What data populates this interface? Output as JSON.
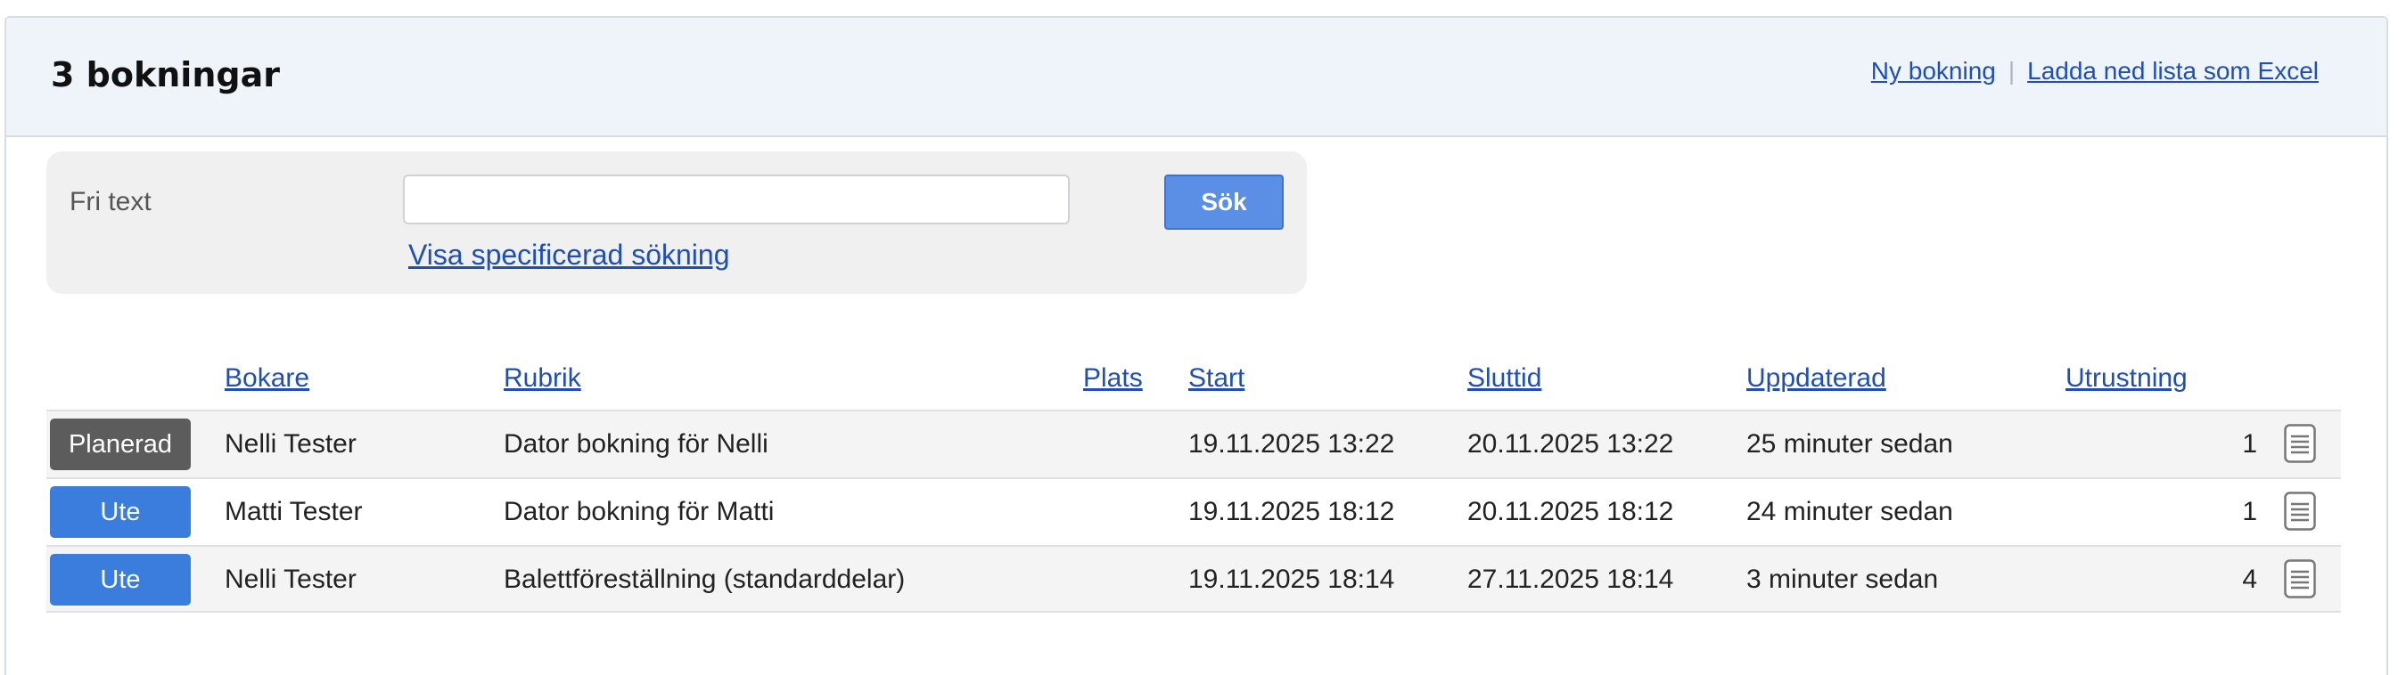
{
  "header": {
    "title": "3 bokningar",
    "links": {
      "new_booking": "Ny bokning",
      "separator": "|",
      "download_excel": "Ladda ned lista som Excel"
    }
  },
  "search": {
    "label": "Fri text",
    "input_value": "",
    "input_placeholder": "",
    "button_label": "Sök",
    "advanced_link": "Visa specificerad sökning"
  },
  "table": {
    "columns": {
      "booker": "Bokare",
      "title": "Rubrik",
      "place": "Plats",
      "start": "Start",
      "end": "Sluttid",
      "updated": "Uppdaterad",
      "equipment": "Utrustning"
    },
    "rows": [
      {
        "status": "Planerad",
        "status_color": "#5c5c5c",
        "booker": "Nelli Tester",
        "title": "Dator bokning för Nelli",
        "place": "",
        "start": "19.11.2025 13:22",
        "end": "20.11.2025 13:22",
        "updated": "25 minuter sedan",
        "equipment": "1",
        "icon": "document-icon"
      },
      {
        "status": "Ute",
        "status_color": "#3b7ddd",
        "booker": "Matti Tester",
        "title": "Dator bokning för Matti",
        "place": "",
        "start": "19.11.2025 18:12",
        "end": "20.11.2025 18:12",
        "updated": "24 minuter sedan",
        "equipment": "1",
        "icon": "document-icon"
      },
      {
        "status": "Ute",
        "status_color": "#3b7ddd",
        "booker": "Nelli Tester",
        "title": "Balettföreställning (standarddelar)",
        "place": "",
        "start": "19.11.2025 18:14",
        "end": "27.11.2025 18:14",
        "updated": "3 minuter sedan",
        "equipment": "4",
        "icon": "document-icon"
      }
    ]
  },
  "colors": {
    "link": "#1f4fb6",
    "header_bg": "#eff4fa",
    "search_button": "#5b8fe6",
    "status_planned": "#5c5c5c",
    "status_out": "#3b7ddd"
  }
}
